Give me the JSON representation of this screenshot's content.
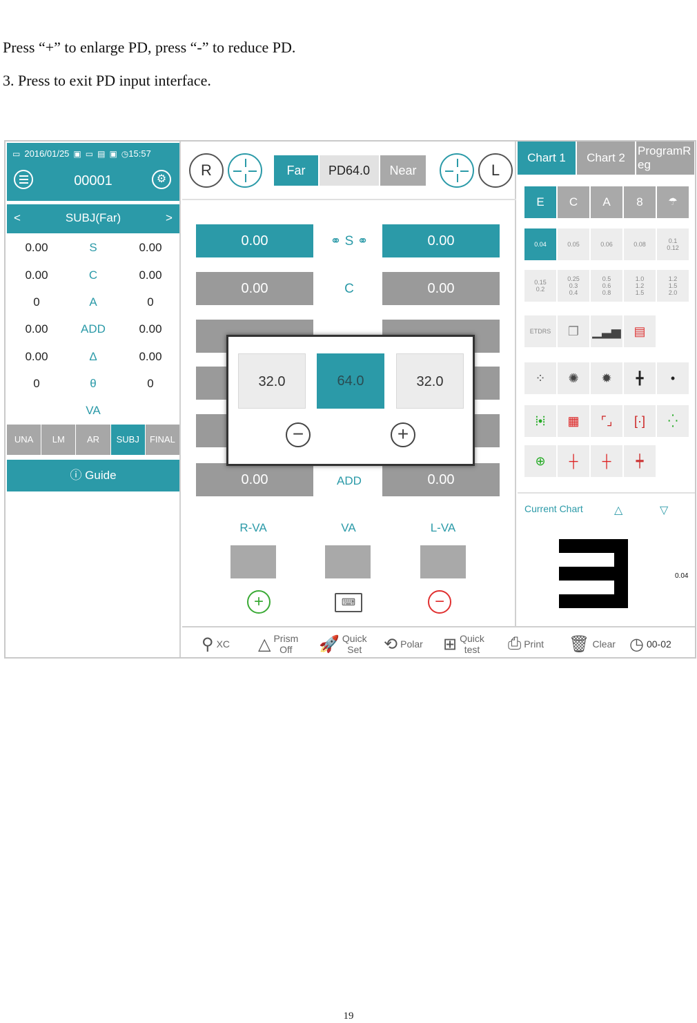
{
  "doc": {
    "line1": "Press “+” to enlarge PD, press “-” to reduce PD.",
    "line2": "3. Press to exit PD input interface.",
    "page_number": "19"
  },
  "screen": {
    "status": {
      "date": "2016/01/25",
      "time": "15:57"
    },
    "patient_id": "00001",
    "mode": {
      "label": "SUBJ(Far)",
      "prev": "<",
      "next": ">"
    },
    "subj_rows": [
      {
        "r": "0.00",
        "name": "S",
        "l": "0.00"
      },
      {
        "r": "0.00",
        "name": "C",
        "l": "0.00"
      },
      {
        "r": "0",
        "name": "A",
        "l": "0"
      },
      {
        "r": "0.00",
        "name": "ADD",
        "l": "0.00"
      },
      {
        "r": "0.00",
        "name": "Δ",
        "l": "0.00"
      },
      {
        "r": "0",
        "name": "θ",
        "l": "0"
      },
      {
        "r": "",
        "name": "VA",
        "l": ""
      }
    ],
    "mode_tabs": [
      "UNA",
      "LM",
      "AR",
      "SUBJ",
      "FINAL"
    ],
    "active_mode_tab": "SUBJ",
    "guide_label": "Guide",
    "top": {
      "right_eye": "R",
      "left_eye": "L",
      "far": "Far",
      "pd": "PD64.0",
      "near": "Near"
    },
    "center": {
      "s_label": "S",
      "c_label": "C",
      "add_label": "ADD",
      "s_r": "0.00",
      "s_l": "0.00",
      "c_r": "0.00",
      "c_l": "0.00",
      "add_r": "0.00",
      "add_l": "0.00",
      "r_va": "R-VA",
      "va": "VA",
      "l_va": "L-VA"
    },
    "pd_popup": {
      "right": "32.0",
      "total": "64.0",
      "left": "32.0",
      "minus": "−",
      "plus": "+"
    },
    "chart_tabs": [
      "Chart 1",
      "Chart 2",
      "ProgramReg"
    ],
    "optotype_row": [
      "E",
      "C",
      "A",
      "8",
      "☂"
    ],
    "acuity_row1": [
      "0.04",
      "0.05",
      "0.06",
      "0.08",
      "0.1\n0.12"
    ],
    "acuity_row2": [
      "0.15\n0.2",
      "0.25\n0.3\n0.4",
      "0.5\n0.6\n0.8",
      "1.0\n1.2\n1.5",
      "1.2\n1.5\n2.0"
    ],
    "etdrs": "ETDRS",
    "current_chart_label": "Current Chart",
    "current_chart_value": "0.04",
    "toolbar": {
      "xc": "XC",
      "prism": "Prism\nOff",
      "quick_set": "Quick\nSet",
      "polar": "Polar",
      "quick_test": "Quick\ntest",
      "print": "Print",
      "clear": "Clear",
      "timer": "00-02"
    },
    "colors": {
      "accent": "#2b9aa8",
      "grey_button": "#9a9a9a",
      "green": "#3aaa35",
      "red": "#e03030"
    }
  }
}
